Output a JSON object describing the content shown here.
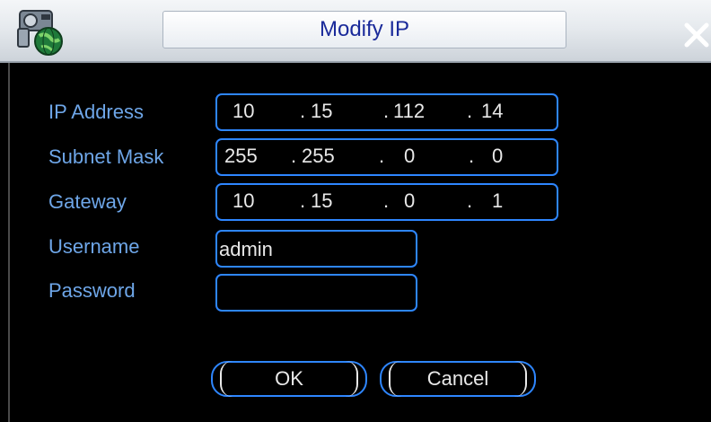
{
  "window": {
    "title": "Modify IP",
    "app_icon": "network-camera-globe-icon",
    "close_icon": "close-icon"
  },
  "form": {
    "ip_address": {
      "label": "IP Address",
      "octets": [
        "10",
        "15",
        "112",
        "14"
      ]
    },
    "subnet_mask": {
      "label": "Subnet Mask",
      "octets": [
        "255",
        "255",
        "0",
        "0"
      ]
    },
    "gateway": {
      "label": "Gateway",
      "octets": [
        "10",
        "15",
        "0",
        "1"
      ]
    },
    "username": {
      "label": "Username",
      "value": "admin"
    },
    "password": {
      "label": "Password",
      "value": ""
    }
  },
  "buttons": {
    "ok": "OK",
    "cancel": "Cancel"
  },
  "colors": {
    "label": "#6ea6e8",
    "field_border": "#2e86ff",
    "title_text": "#1a2a9a",
    "value_text": "#e9e9e9"
  }
}
